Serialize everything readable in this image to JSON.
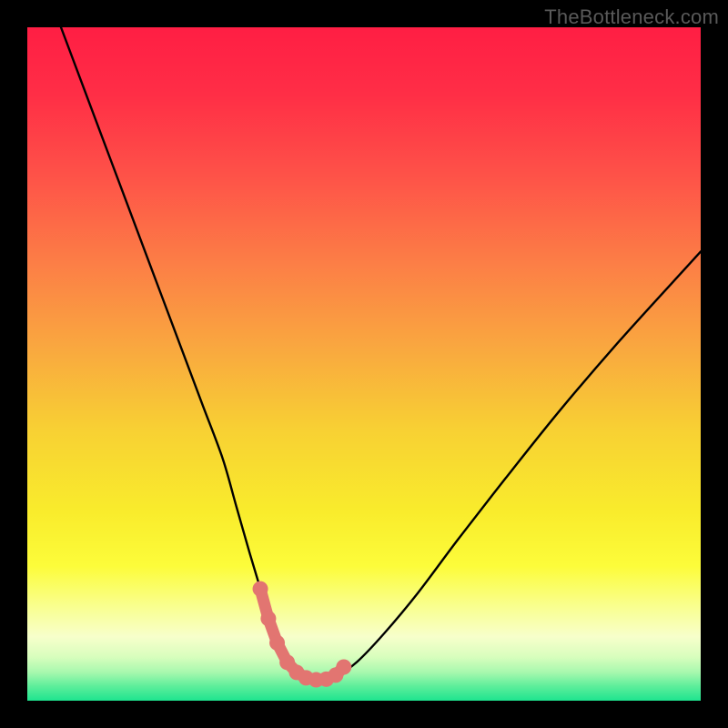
{
  "watermark": {
    "text": "TheBottleneck.com"
  },
  "colors": {
    "black": "#000000",
    "curve": "#000000",
    "beads": "#E27571",
    "gradient_stops": [
      {
        "offset": 0.0,
        "color": "#FF1E44"
      },
      {
        "offset": 0.1,
        "color": "#FF2E46"
      },
      {
        "offset": 0.22,
        "color": "#FE5248"
      },
      {
        "offset": 0.35,
        "color": "#FC7E46"
      },
      {
        "offset": 0.48,
        "color": "#F9A93F"
      },
      {
        "offset": 0.6,
        "color": "#F8D133"
      },
      {
        "offset": 0.72,
        "color": "#F9EC2C"
      },
      {
        "offset": 0.8,
        "color": "#FCFC3A"
      },
      {
        "offset": 0.86,
        "color": "#F9FF8F"
      },
      {
        "offset": 0.905,
        "color": "#F7FFCB"
      },
      {
        "offset": 0.935,
        "color": "#D8FEBD"
      },
      {
        "offset": 0.958,
        "color": "#A7F8AE"
      },
      {
        "offset": 0.978,
        "color": "#5FEE9B"
      },
      {
        "offset": 1.0,
        "color": "#1EE48F"
      }
    ]
  },
  "chart_data": {
    "type": "line",
    "title": "",
    "xlabel": "",
    "ylabel": "",
    "xlim": [
      0,
      100
    ],
    "ylim": [
      0,
      100
    ],
    "grid": false,
    "series": [
      {
        "name": "bottleneck-curve",
        "x": [
          5,
          8,
          11,
          14,
          17,
          20,
          23,
          26,
          29,
          31,
          33,
          34.5,
          36,
          37.5,
          39,
          40,
          41,
          42,
          44,
          46,
          49,
          53,
          58,
          64,
          71,
          79,
          88,
          98,
          100
        ],
        "y": [
          100,
          92,
          84,
          76,
          68,
          60,
          52,
          44,
          36,
          29,
          22,
          17,
          12,
          8.5,
          5.6,
          4.2,
          3.3,
          3.1,
          3.1,
          3.7,
          5.8,
          10,
          16,
          24,
          33,
          43,
          53.5,
          64.5,
          66.7
        ]
      },
      {
        "name": "highlight-beads",
        "x": [
          34.6,
          35.8,
          37.1,
          38.6,
          40.0,
          41.4,
          42.9,
          44.4,
          45.8,
          47.0
        ],
        "y": [
          16.6,
          12.2,
          8.6,
          5.7,
          4.2,
          3.4,
          3.1,
          3.2,
          3.8,
          5.0
        ]
      }
    ]
  }
}
